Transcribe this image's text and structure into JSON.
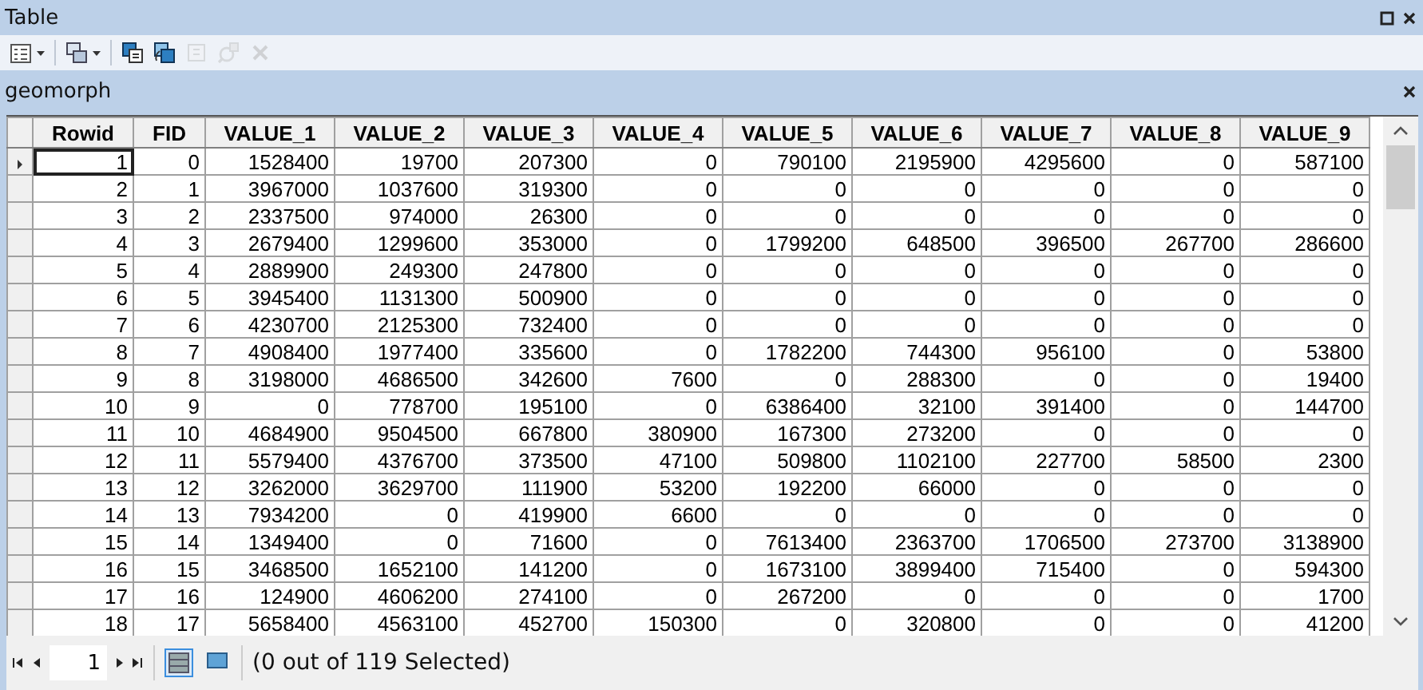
{
  "window": {
    "title": "Table",
    "buttons": [
      {
        "kind": "restore"
      },
      {
        "kind": "close"
      }
    ]
  },
  "toolbar": [
    {
      "kind": "options",
      "dropdown": true,
      "disabled": false
    },
    {
      "kind": "related",
      "dropdown": true,
      "disabled": false
    },
    {
      "kind": "select",
      "dropdown": false,
      "disabled": false
    },
    {
      "kind": "switch",
      "dropdown": false,
      "disabled": false
    },
    {
      "kind": "clear",
      "dropdown": false,
      "disabled": true
    },
    {
      "kind": "zoom",
      "dropdown": false,
      "disabled": true
    },
    {
      "kind": "delete",
      "dropdown": false,
      "disabled": true
    }
  ],
  "tab": {
    "label": "geomorph",
    "closable": true
  },
  "table": {
    "columns": [
      "Rowid",
      "FID",
      "VALUE_1",
      "VALUE_2",
      "VALUE_3",
      "VALUE_4",
      "VALUE_5",
      "VALUE_6",
      "VALUE_7",
      "VALUE_8",
      "VALUE_9"
    ],
    "rows": [
      {
        "current": true,
        "selected": false,
        "cells": [
          "1",
          "0",
          "1528400",
          "19700",
          "207300",
          "0",
          "790100",
          "2195900",
          "4295600",
          "0",
          "587100"
        ]
      },
      {
        "current": false,
        "selected": false,
        "cells": [
          "2",
          "1",
          "3967000",
          "1037600",
          "319300",
          "0",
          "0",
          "0",
          "0",
          "0",
          "0"
        ]
      },
      {
        "current": false,
        "selected": false,
        "cells": [
          "3",
          "2",
          "2337500",
          "974000",
          "26300",
          "0",
          "0",
          "0",
          "0",
          "0",
          "0"
        ]
      },
      {
        "current": false,
        "selected": false,
        "cells": [
          "4",
          "3",
          "2679400",
          "1299600",
          "353000",
          "0",
          "1799200",
          "648500",
          "396500",
          "267700",
          "286600"
        ]
      },
      {
        "current": false,
        "selected": false,
        "cells": [
          "5",
          "4",
          "2889900",
          "249300",
          "247800",
          "0",
          "0",
          "0",
          "0",
          "0",
          "0"
        ]
      },
      {
        "current": false,
        "selected": false,
        "cells": [
          "6",
          "5",
          "3945400",
          "1131300",
          "500900",
          "0",
          "0",
          "0",
          "0",
          "0",
          "0"
        ]
      },
      {
        "current": false,
        "selected": false,
        "cells": [
          "7",
          "6",
          "4230700",
          "2125300",
          "732400",
          "0",
          "0",
          "0",
          "0",
          "0",
          "0"
        ]
      },
      {
        "current": false,
        "selected": false,
        "cells": [
          "8",
          "7",
          "4908400",
          "1977400",
          "335600",
          "0",
          "1782200",
          "744300",
          "956100",
          "0",
          "53800"
        ]
      },
      {
        "current": false,
        "selected": false,
        "cells": [
          "9",
          "8",
          "3198000",
          "4686500",
          "342600",
          "7600",
          "0",
          "288300",
          "0",
          "0",
          "19400"
        ]
      },
      {
        "current": false,
        "selected": false,
        "cells": [
          "10",
          "9",
          "0",
          "778700",
          "195100",
          "0",
          "6386400",
          "32100",
          "391400",
          "0",
          "144700"
        ]
      },
      {
        "current": false,
        "selected": false,
        "cells": [
          "11",
          "10",
          "4684900",
          "9504500",
          "667800",
          "380900",
          "167300",
          "273200",
          "0",
          "0",
          "0"
        ]
      },
      {
        "current": false,
        "selected": false,
        "cells": [
          "12",
          "11",
          "5579400",
          "4376700",
          "373500",
          "47100",
          "509800",
          "1102100",
          "227700",
          "58500",
          "2300"
        ]
      },
      {
        "current": false,
        "selected": false,
        "cells": [
          "13",
          "12",
          "3262000",
          "3629700",
          "111900",
          "53200",
          "192200",
          "66000",
          "0",
          "0",
          "0"
        ]
      },
      {
        "current": false,
        "selected": false,
        "cells": [
          "14",
          "13",
          "7934200",
          "0",
          "419900",
          "6600",
          "0",
          "0",
          "0",
          "0",
          "0"
        ]
      },
      {
        "current": false,
        "selected": false,
        "cells": [
          "15",
          "14",
          "1349400",
          "0",
          "71600",
          "0",
          "7613400",
          "2363700",
          "1706500",
          "273700",
          "3138900"
        ]
      },
      {
        "current": false,
        "selected": false,
        "cells": [
          "16",
          "15",
          "3468500",
          "1652100",
          "141200",
          "0",
          "1673100",
          "3899400",
          "715400",
          "0",
          "594300"
        ]
      },
      {
        "current": false,
        "selected": false,
        "cells": [
          "17",
          "16",
          "124900",
          "4606200",
          "274100",
          "0",
          "267200",
          "0",
          "0",
          "0",
          "1700"
        ]
      },
      {
        "current": false,
        "selected": false,
        "cells": [
          "18",
          "17",
          "5658400",
          "4563100",
          "452700",
          "150300",
          "0",
          "320800",
          "0",
          "0",
          "41200"
        ]
      }
    ]
  },
  "status_bar": {
    "page": "1",
    "views": [
      {
        "kind": "all",
        "selected": true
      },
      {
        "kind": "selected",
        "selected": false
      }
    ],
    "status": "(0 out of 119 Selected)"
  }
}
